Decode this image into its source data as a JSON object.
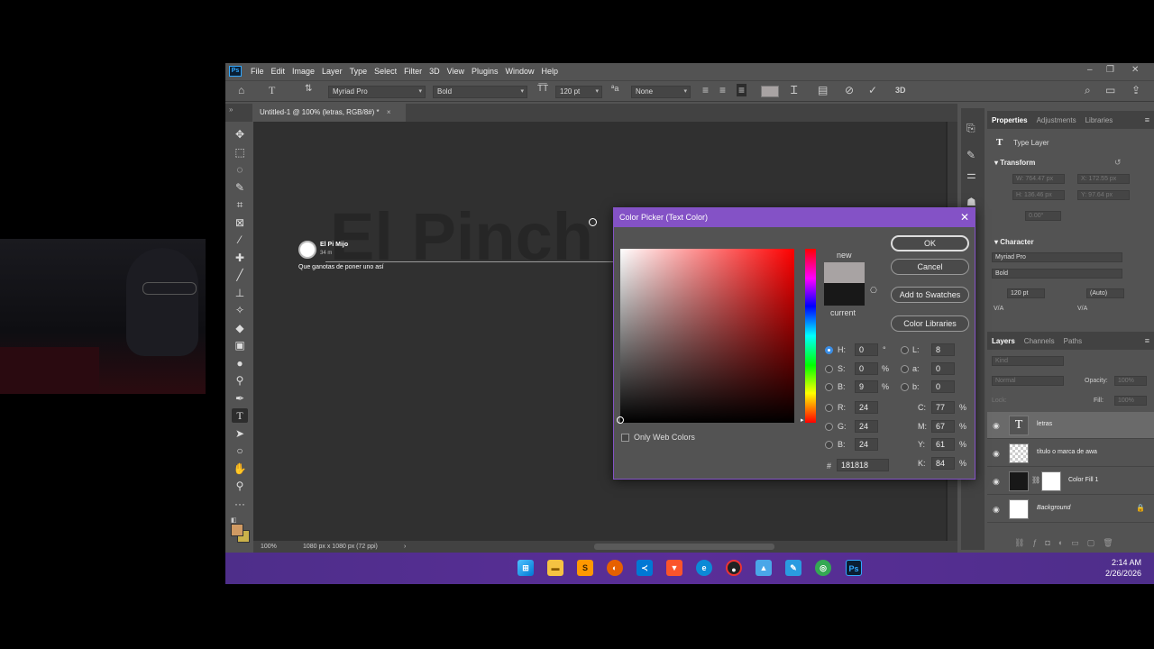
{
  "app": {
    "logo": "Ps",
    "menu": [
      "File",
      "Edit",
      "Image",
      "Layer",
      "Type",
      "Select",
      "Filter",
      "3D",
      "View",
      "Plugins",
      "Window",
      "Help"
    ]
  },
  "options": {
    "font_family": "Myriad Pro",
    "font_style": "Bold",
    "font_size": "120 pt",
    "antialias": "None"
  },
  "document": {
    "tab_title": "Untitled-1 @ 100% (letras, RGB/8#) *",
    "canvas_text": "El Pinch",
    "post_author": "El Pi   Mijo",
    "post_time": "34 m",
    "post_text": "Que ganotas de poner uno así",
    "zoom": "100%",
    "doc_size": "1080 px x 1080 px (72 ppi)"
  },
  "panels": {
    "top_tabs": [
      "Properties",
      "Adjustments",
      "Libraries"
    ],
    "layer_kind": "Type Layer",
    "transform_heading": "Transform",
    "transform": {
      "w": "W: 764.47 px",
      "x": "X: 172.55 px",
      "h": "H: 136.46 px",
      "y": "Y: 97.64 px",
      "angle": "0.00°"
    },
    "character_heading": "Character",
    "char_font": "Myriad Pro",
    "char_style": "Bold",
    "char_size": "120 pt",
    "char_leading": "(Auto)",
    "va_label": "V/A",
    "layer_tabs": [
      "Layers",
      "Channels",
      "Paths"
    ],
    "kind_placeholder": "Kind",
    "blend_mode": "Normal",
    "opacity_label": "Opacity:",
    "opacity_value": "100%",
    "lock_label": "Lock:",
    "fill_label": "Fill:",
    "fill_value": "100%",
    "layers": [
      "letras",
      "título o  marca de awa",
      "Color Fill 1",
      "Background"
    ]
  },
  "dialog": {
    "title": "Color Picker (Text Color)",
    "buttons": {
      "ok": "OK",
      "cancel": "Cancel",
      "add_swatches": "Add to Swatches",
      "color_libraries": "Color Libraries"
    },
    "new_label": "new",
    "current_label": "current",
    "new_color": "#a8a3a3",
    "current_color": "#181818",
    "only_web_colors": "Only Web Colors",
    "fields": {
      "H": {
        "label": "H:",
        "value": "0",
        "unit": "°"
      },
      "S": {
        "label": "S:",
        "value": "0",
        "unit": "%"
      },
      "B": {
        "label": "B:",
        "value": "9",
        "unit": "%"
      },
      "R": {
        "label": "R:",
        "value": "24"
      },
      "G": {
        "label": "G:",
        "value": "24"
      },
      "Bb": {
        "label": "B:",
        "value": "24"
      },
      "L": {
        "label": "L:",
        "value": "8"
      },
      "a": {
        "label": "a:",
        "value": "0"
      },
      "b": {
        "label": "b:",
        "value": "0"
      },
      "C": {
        "label": "C:",
        "value": "77",
        "unit": "%"
      },
      "M": {
        "label": "M:",
        "value": "67",
        "unit": "%"
      },
      "Y": {
        "label": "Y:",
        "value": "61",
        "unit": "%"
      },
      "K": {
        "label": "K:",
        "value": "84",
        "unit": "%"
      },
      "hex_label": "#",
      "hex": "181818"
    }
  },
  "taskbar": {
    "time": "2:14 AM",
    "date": "2/26/2026",
    "apps": [
      "windows-start",
      "file-explorer",
      "sublime",
      "firefox",
      "vscode",
      "brave",
      "edge",
      "chrome",
      "photos",
      "paint",
      "chrome-alt",
      "photoshop"
    ]
  },
  "colors": {
    "accent": "#8452c6",
    "ps_blue": "#31a8ff",
    "fg_swatch": "#d09a63",
    "bg_swatch": "#cbb14a"
  }
}
